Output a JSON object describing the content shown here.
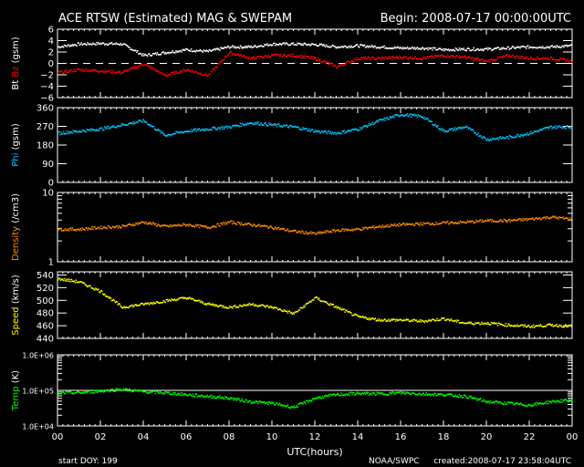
{
  "chart_data": {
    "type": "scatter",
    "title": "ACE RTSW (Estimated) MAG & SWEPAM",
    "begin": "Begin: 2008-07-17 00:00:00UTC",
    "xlabel": "UTC(hours)",
    "xlim": [
      0,
      24
    ],
    "xticks": [
      "00",
      "02",
      "04",
      "06",
      "08",
      "10",
      "12",
      "14",
      "16",
      "18",
      "20",
      "22",
      "00"
    ],
    "x": [
      0,
      1,
      2,
      3,
      4,
      5,
      6,
      7,
      8,
      9,
      10,
      11,
      12,
      13,
      14,
      15,
      16,
      17,
      18,
      19,
      20,
      21,
      22,
      23,
      24
    ],
    "footer_left": "start DOY: 199",
    "footer_mid": "NOAA/SWPC",
    "footer_right": "created:2008-07-17 23:58:04UTC",
    "panels": [
      {
        "id": "mag",
        "ylabel_parts": [
          "Bt",
          "Bz",
          "(gsm)"
        ],
        "scale": "linear",
        "ylim": [
          -6,
          6
        ],
        "yticks": [
          "6",
          "4",
          "2",
          "0",
          "−2",
          "−4",
          "−6"
        ],
        "ytick_values": [
          6,
          4,
          2,
          0,
          -2,
          -4,
          -6
        ],
        "zero_line": true,
        "series": [
          {
            "name": "Bt",
            "color": "#ffffff",
            "values": [
              3,
              3.5,
              3.6,
              3.5,
              1.5,
              2,
              2.5,
              2.2,
              3,
              3,
              3.5,
              3.5,
              3.4,
              3,
              3.2,
              3,
              2.8,
              2.8,
              2.5,
              2.6,
              2.6,
              2.8,
              3,
              3,
              3.2
            ]
          },
          {
            "name": "Bz",
            "color": "#ff0000",
            "values": [
              -1.5,
              -1,
              -1.2,
              -1.5,
              0,
              -2,
              -1,
              -2,
              2,
              1,
              1.5,
              1.5,
              1,
              -0.5,
              1,
              1,
              1.2,
              1,
              1.5,
              1.2,
              0.5,
              1.5,
              1,
              1,
              0.5
            ]
          }
        ]
      },
      {
        "id": "phi",
        "ylabel_parts": [
          "Phi",
          "(gsm)"
        ],
        "scale": "linear",
        "ylim": [
          0,
          360
        ],
        "yticks": [
          "360",
          "270",
          "180",
          "90",
          "0"
        ],
        "ytick_values": [
          360,
          270,
          180,
          90,
          0
        ],
        "series": [
          {
            "name": "Phi",
            "color": "#00c8ff",
            "values": [
              240,
              250,
              260,
              280,
              300,
              230,
              250,
              260,
              270,
              290,
              280,
              270,
              250,
              240,
              260,
              300,
              330,
              320,
              250,
              270,
              210,
              220,
              240,
              270,
              270
            ]
          }
        ]
      },
      {
        "id": "density",
        "ylabel_parts": [
          "Density",
          "(/cm3)"
        ],
        "scale": "log",
        "ylim": [
          1,
          10
        ],
        "yticks": [
          "10",
          "1"
        ],
        "ytick_values": [
          10,
          1
        ],
        "series": [
          {
            "name": "Density",
            "color": "#ff8c00",
            "values": [
              3,
              3,
              3.2,
              3.3,
              3.8,
              3.3,
              3.5,
              3.2,
              3.8,
              3.5,
              3.2,
              2.8,
              2.6,
              2.9,
              3,
              3.3,
              3.5,
              3.6,
              3.7,
              3.8,
              4,
              4,
              4.2,
              4.5,
              4.2
            ]
          }
        ]
      },
      {
        "id": "speed",
        "ylabel_parts": [
          "Speed",
          "(km/s)"
        ],
        "scale": "linear",
        "ylim": [
          440,
          545
        ],
        "yticks": [
          "540",
          "520",
          "500",
          "480",
          "460",
          "440"
        ],
        "ytick_values": [
          540,
          520,
          500,
          480,
          460,
          440
        ],
        "series": [
          {
            "name": "Speed",
            "color": "#ffff00",
            "values": [
              535,
              530,
              515,
              490,
              495,
              500,
              505,
              495,
              490,
              495,
              490,
              480,
              505,
              490,
              475,
              470,
              470,
              468,
              472,
              465,
              465,
              462,
              460,
              462,
              460
            ]
          }
        ]
      },
      {
        "id": "temp",
        "ylabel_parts": [
          "Temp",
          "(K)"
        ],
        "scale": "log",
        "ylim": [
          10000,
          1000000
        ],
        "yticks": [
          "1.0E+06",
          "1.0E+05",
          "1.0E+04"
        ],
        "ytick_values": [
          1000000,
          100000,
          10000
        ],
        "ref_line": 100000,
        "series": [
          {
            "name": "Temp",
            "color": "#00ff00",
            "values": [
              89000,
              89000,
              100000,
              112000,
              95000,
              89000,
              79000,
              71000,
              63000,
              50000,
              45000,
              35000,
              63000,
              79000,
              85000,
              83000,
              89000,
              83000,
              79000,
              71000,
              50000,
              45000,
              40000,
              50000,
              56000
            ]
          }
        ]
      }
    ]
  }
}
